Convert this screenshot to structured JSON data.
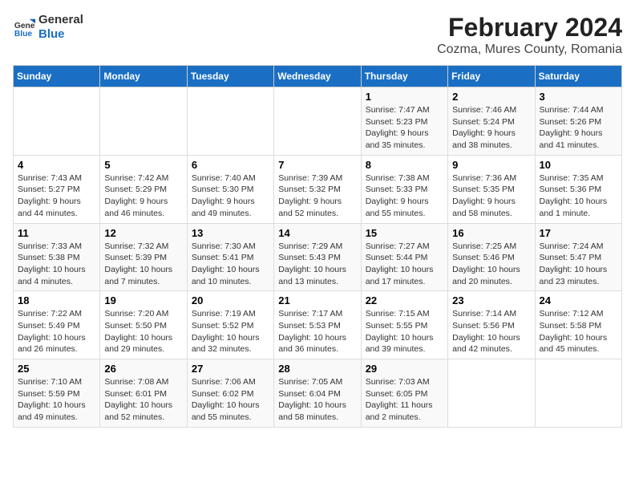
{
  "header": {
    "logo_line1": "General",
    "logo_line2": "Blue",
    "title": "February 2024",
    "subtitle": "Cozma, Mures County, Romania"
  },
  "columns": [
    "Sunday",
    "Monday",
    "Tuesday",
    "Wednesday",
    "Thursday",
    "Friday",
    "Saturday"
  ],
  "rows": [
    [
      {
        "day": "",
        "info": ""
      },
      {
        "day": "",
        "info": ""
      },
      {
        "day": "",
        "info": ""
      },
      {
        "day": "",
        "info": ""
      },
      {
        "day": "1",
        "info": "Sunrise: 7:47 AM\nSunset: 5:23 PM\nDaylight: 9 hours and 35 minutes."
      },
      {
        "day": "2",
        "info": "Sunrise: 7:46 AM\nSunset: 5:24 PM\nDaylight: 9 hours and 38 minutes."
      },
      {
        "day": "3",
        "info": "Sunrise: 7:44 AM\nSunset: 5:26 PM\nDaylight: 9 hours and 41 minutes."
      }
    ],
    [
      {
        "day": "4",
        "info": "Sunrise: 7:43 AM\nSunset: 5:27 PM\nDaylight: 9 hours and 44 minutes."
      },
      {
        "day": "5",
        "info": "Sunrise: 7:42 AM\nSunset: 5:29 PM\nDaylight: 9 hours and 46 minutes."
      },
      {
        "day": "6",
        "info": "Sunrise: 7:40 AM\nSunset: 5:30 PM\nDaylight: 9 hours and 49 minutes."
      },
      {
        "day": "7",
        "info": "Sunrise: 7:39 AM\nSunset: 5:32 PM\nDaylight: 9 hours and 52 minutes."
      },
      {
        "day": "8",
        "info": "Sunrise: 7:38 AM\nSunset: 5:33 PM\nDaylight: 9 hours and 55 minutes."
      },
      {
        "day": "9",
        "info": "Sunrise: 7:36 AM\nSunset: 5:35 PM\nDaylight: 9 hours and 58 minutes."
      },
      {
        "day": "10",
        "info": "Sunrise: 7:35 AM\nSunset: 5:36 PM\nDaylight: 10 hours and 1 minute."
      }
    ],
    [
      {
        "day": "11",
        "info": "Sunrise: 7:33 AM\nSunset: 5:38 PM\nDaylight: 10 hours and 4 minutes."
      },
      {
        "day": "12",
        "info": "Sunrise: 7:32 AM\nSunset: 5:39 PM\nDaylight: 10 hours and 7 minutes."
      },
      {
        "day": "13",
        "info": "Sunrise: 7:30 AM\nSunset: 5:41 PM\nDaylight: 10 hours and 10 minutes."
      },
      {
        "day": "14",
        "info": "Sunrise: 7:29 AM\nSunset: 5:43 PM\nDaylight: 10 hours and 13 minutes."
      },
      {
        "day": "15",
        "info": "Sunrise: 7:27 AM\nSunset: 5:44 PM\nDaylight: 10 hours and 17 minutes."
      },
      {
        "day": "16",
        "info": "Sunrise: 7:25 AM\nSunset: 5:46 PM\nDaylight: 10 hours and 20 minutes."
      },
      {
        "day": "17",
        "info": "Sunrise: 7:24 AM\nSunset: 5:47 PM\nDaylight: 10 hours and 23 minutes."
      }
    ],
    [
      {
        "day": "18",
        "info": "Sunrise: 7:22 AM\nSunset: 5:49 PM\nDaylight: 10 hours and 26 minutes."
      },
      {
        "day": "19",
        "info": "Sunrise: 7:20 AM\nSunset: 5:50 PM\nDaylight: 10 hours and 29 minutes."
      },
      {
        "day": "20",
        "info": "Sunrise: 7:19 AM\nSunset: 5:52 PM\nDaylight: 10 hours and 32 minutes."
      },
      {
        "day": "21",
        "info": "Sunrise: 7:17 AM\nSunset: 5:53 PM\nDaylight: 10 hours and 36 minutes."
      },
      {
        "day": "22",
        "info": "Sunrise: 7:15 AM\nSunset: 5:55 PM\nDaylight: 10 hours and 39 minutes."
      },
      {
        "day": "23",
        "info": "Sunrise: 7:14 AM\nSunset: 5:56 PM\nDaylight: 10 hours and 42 minutes."
      },
      {
        "day": "24",
        "info": "Sunrise: 7:12 AM\nSunset: 5:58 PM\nDaylight: 10 hours and 45 minutes."
      }
    ],
    [
      {
        "day": "25",
        "info": "Sunrise: 7:10 AM\nSunset: 5:59 PM\nDaylight: 10 hours and 49 minutes."
      },
      {
        "day": "26",
        "info": "Sunrise: 7:08 AM\nSunset: 6:01 PM\nDaylight: 10 hours and 52 minutes."
      },
      {
        "day": "27",
        "info": "Sunrise: 7:06 AM\nSunset: 6:02 PM\nDaylight: 10 hours and 55 minutes."
      },
      {
        "day": "28",
        "info": "Sunrise: 7:05 AM\nSunset: 6:04 PM\nDaylight: 10 hours and 58 minutes."
      },
      {
        "day": "29",
        "info": "Sunrise: 7:03 AM\nSunset: 6:05 PM\nDaylight: 11 hours and 2 minutes."
      },
      {
        "day": "",
        "info": ""
      },
      {
        "day": "",
        "info": ""
      }
    ]
  ]
}
